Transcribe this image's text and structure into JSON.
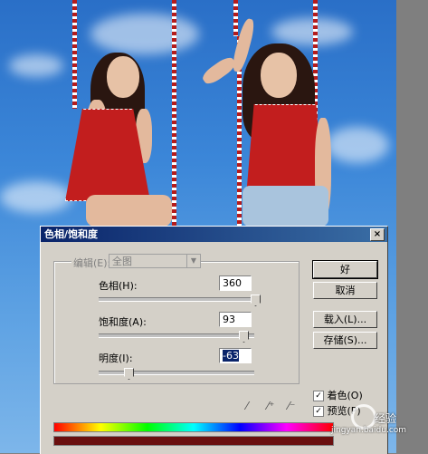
{
  "dialog": {
    "title": "色相/饱和度",
    "close": "×",
    "edit": {
      "label": "编辑(E):",
      "value": "全图"
    },
    "hue": {
      "label": "色相(H):",
      "value": "360",
      "level_percent": 100
    },
    "saturation": {
      "label": "饱和度(A):",
      "value": "93",
      "level_percent": 93
    },
    "lightness": {
      "label": "明度(I):",
      "value": "-63",
      "level_percent": 18
    },
    "buttons": {
      "ok": "好",
      "cancel": "取消",
      "load": "载入(L)...",
      "save": "存储(S)..."
    },
    "colorize": {
      "label": "着色(O)",
      "checked": true
    },
    "preview": {
      "label": "预览(P)",
      "checked": true
    },
    "result_color": "#6a0f0f"
  },
  "watermark": {
    "brand": "经验",
    "site": "jingyan.baidu.com"
  },
  "icons": [
    "eyedropper-icon",
    "eyedropper-plus-icon",
    "eyedropper-minus-icon"
  ]
}
